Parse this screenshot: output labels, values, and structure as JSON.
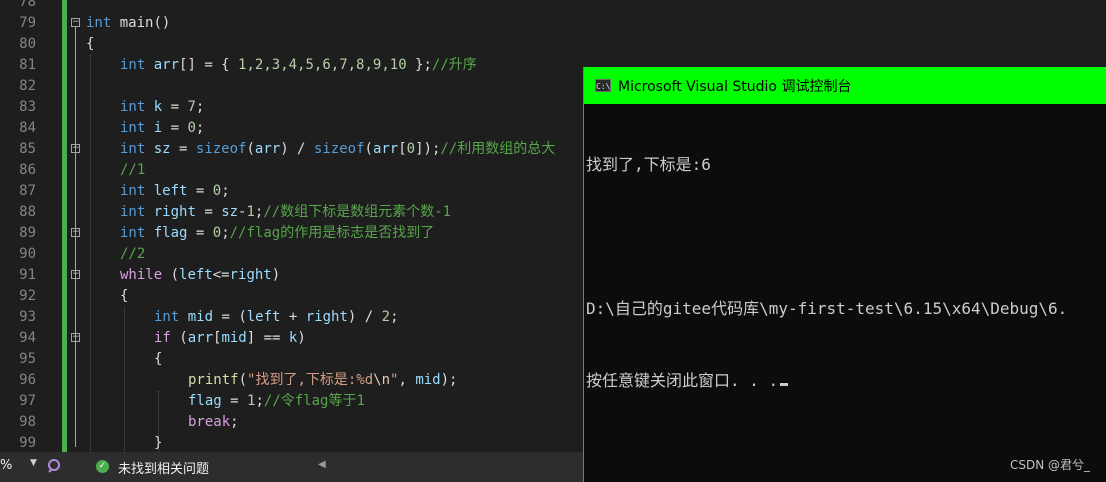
{
  "editor": {
    "line_numbers": [
      "78",
      "79",
      "80",
      "81",
      "82",
      "83",
      "84",
      "85",
      "86",
      "87",
      "88",
      "89",
      "90",
      "91",
      "92",
      "93",
      "94",
      "95",
      "96",
      "97",
      "98",
      "99"
    ],
    "lines": {
      "l79": {
        "kw": "int",
        "rest": " main()"
      },
      "l80": {
        "brace": "{"
      },
      "l81": {
        "kw": "int",
        "id": "arr",
        "p1": "[] = { ",
        "nums": "1,2,3,4,5,6,7,8,9,10",
        "p2": " };",
        "comment": "//升序"
      },
      "l83": {
        "kw": "int",
        "id": "k",
        "p1": " = ",
        "num": "7",
        "p2": ";"
      },
      "l84": {
        "kw": "int",
        "id": "i",
        "p1": " = ",
        "num": "0",
        "p2": ";"
      },
      "l85": {
        "kw": "int",
        "id": "sz",
        "p1": " = ",
        "fn1": "sizeof",
        "p2": "(",
        "id2": "arr",
        "p3": ") / ",
        "fn2": "sizeof",
        "p4": "(",
        "id3": "arr",
        "p5": "[",
        "num": "0",
        "p6": "]);",
        "comment": "//利用数组的总大"
      },
      "l86": {
        "comment": "//1"
      },
      "l87": {
        "kw": "int",
        "id": "left",
        "p1": " = ",
        "num": "0",
        "p2": ";"
      },
      "l88": {
        "kw": "int",
        "id": "right",
        "p1": " = ",
        "id2": "sz",
        "op": "-",
        "num": "1",
        "p2": ";",
        "comment": "//数组下标是数组元素个数-1"
      },
      "l89": {
        "kw": "int",
        "id": "flag",
        "p1": " = ",
        "num": "0",
        "p2": ";",
        "comment": "//flag的作用是标志是否找到了"
      },
      "l90": {
        "comment": "//2"
      },
      "l91": {
        "kw": "while",
        "p1": " (",
        "id": "left",
        "op": "<=",
        "id2": "right",
        "p2": ")"
      },
      "l92": {
        "brace": "{"
      },
      "l93": {
        "kw": "int",
        "id": "mid",
        "p1": " = (",
        "id2": "left",
        "p2": " + ",
        "id3": "right",
        "p3": ") / ",
        "num": "2",
        "p4": ";"
      },
      "l94": {
        "kw": "if",
        "p1": " (",
        "id": "arr",
        "p2": "[",
        "id2": "mid",
        "p3": "] == ",
        "id3": "k",
        "p4": ")"
      },
      "l95": {
        "brace": "{"
      },
      "l96": {
        "fn": "printf",
        "p1": "(",
        "str1": "\"找到了,下标是:%d",
        "esc": "\\n",
        "str2": "\"",
        "p2": ", ",
        "id": "mid",
        "p3": ");"
      },
      "l97": {
        "id": "flag",
        "p1": " = ",
        "num": "1",
        "p2": ";",
        "comment": "//令flag等于1"
      },
      "l98": {
        "kw": "break",
        "p1": ";"
      },
      "l99": {
        "brace": "}"
      }
    }
  },
  "statusbar": {
    "zoom": "%",
    "issues": "未找到相关问题"
  },
  "console": {
    "title": "Microsoft Visual Studio 调试控制台",
    "icon_text": "C:\\",
    "lines": [
      "找到了,下标是:6",
      "",
      "D:\\自己的gitee代码库\\my-first-test\\6.15\\x64\\Debug\\6.",
      "按任意键关闭此窗口. . ."
    ]
  },
  "watermark": "CSDN @君兮_",
  "colors": {
    "title_bar": "#00ff00",
    "change_bar": "#4bae4f",
    "keyword": "#569cd6",
    "control": "#d8a0df",
    "comment": "#57a64a"
  }
}
